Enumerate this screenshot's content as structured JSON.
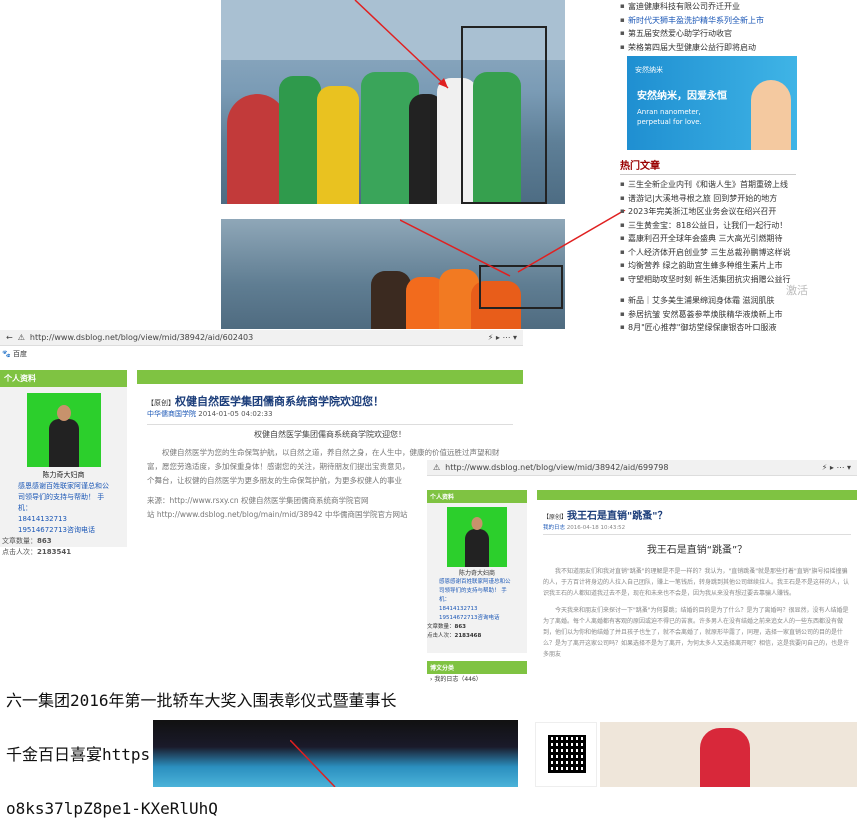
{
  "top_sidebar": {
    "items_top": [
      "富迪健康科技有限公司乔迁开业",
      "新时代天狮丰盈洗护精华系列全新上市",
      "第五届安然爱心助学行动收官",
      "荣格第四届大型健康公益行即将启动"
    ],
    "ad_brand": "安然纳米",
    "ad_brand_slogan": "因爱永恒",
    "ad_line1": "安然纳米，因爱永恒",
    "ad_line2": "Anran nanometer,",
    "ad_line3": "perpetual for love.",
    "hot_title": "热门文章",
    "hot_items": [
      "三生全新企业内刊《和谐人生》首期重磅上线",
      "谱游记|大溪地寻根之旅 回到梦开始的地方",
      "2023年完美浙江地区业务会议在绍兴召开",
      "三生黄金宝：818公益日，让我们一起行动！",
      "嘉康利召开全球年会盛典 三大高光引燃期待",
      "个人经济体开启创业梦 三生总裁孙鹏博这样说",
      "均衡营养 绿之韵助宜生蜂多种维生素片上市",
      "守望相助攻坚时刻 新生活集团抗灾捐赠公益行",
      "新品｜艾多美生浦果绵润身体霜 滋润肌肤",
      "参居抗皱 安然葛荟参萃焕肤精华液焕新上市",
      "8月\"匠心推荐\"御坊堂绿保康银杏叶口服液"
    ],
    "watermark": "激活"
  },
  "browser1": {
    "url": "http://www.dsblog.net/blog/view/mid/38942/aid/602403",
    "tab": "百度",
    "profile_header": "个人资料",
    "user_name": "陈力奇大妇商",
    "user_desc": "感恩感谢百姓联家阿谨总和公司领导们的支持与帮助！  手机：",
    "phones": "18414132713 19514672713咨询电话",
    "stats_articles_label": "文章数量：",
    "stats_articles": "863",
    "stats_visits_label": "点击人次：",
    "stats_visits": "2183541",
    "badge": "原创",
    "title": "权健自然医学集团儒商系统商学院欢迎您！",
    "meta_source": "中华儒商国学院",
    "meta_date": "2014-01-05 04:02:33",
    "heading": "权健自然医学集团儒商系统商学院欢迎您！",
    "para1": "权健自然医学为您的生命保驾护航，以自然之道，养自然之身，在人生中，健康的价值远胜过声望和财富，愿您劳逸适度，多加保重身体！感谢您的关注，期待朋友们提出宝贵意见，",
    "para2": "个舞台，让权健的自然医学为更多朋友的生命保驾护航，为更多权健人的事业",
    "source_line": "来源：http://www.rsxy.cn   权健自然医学集团儒商系统商学院官网",
    "station_line": "站  http://www.dsblog.net/blog/main/mid/38942 中华儒商国学院官方网站"
  },
  "browser2": {
    "url": "http://www.dsblog.net/blog/view/mid/38942/aid/699798",
    "profile_header": "个人资料",
    "user_name": "陈力奇大妇商",
    "user_desc": "感恩感谢百姓联家阿谨总和公司领导们的支持与帮助！  手机：",
    "phones": "18414132713 19514672713咨询电话",
    "stats_articles_label": "文章数量：",
    "stats_articles": "863",
    "stats_visits_label": "点击人次：",
    "stats_visits": "2183468",
    "category_header": "博文分类",
    "category_item": "我的日志（446）",
    "badge": "原创",
    "title": "我王石是直销\"跳蚤\"？",
    "meta_source": "我的日志",
    "meta_date": "2016-04-18 10:43:52",
    "heading": "我王石是直销“跳蚤”？",
    "para1": "我不知道朋友们和我对直销\"跳蚤\"的理解是不是一样的？我认为，\"直销跳蚤\"就是那些打着\"直销\"旗号招摇撞骗的人，于方百计将身边的人拉入自己团队，赚上一笔钱后，转身跳到其他公司继续拉人。我王石是不是这样的人，认识我王石的人都知道我过去不是，现在和未来也不会是，因为我从来没有想过要去靠骗人赚钱。",
    "para2": "今天我来和朋友们来探讨一下\"跳蚤\"为何要跳；结婚的目的是为了什么？是为了离婚吗？很显然，没有人结婚是为了离婚。每个人离婚都有客观的原因或迫不得已的苦衷。许多男人在没有结婚之前来追女人的一些东西都没有做到，他们以为你和他结婚了并且孩子也生了，就不会离婚了，就原形毕露了，同理，选择一家直销公司的目的是什么？是为了离开这家公司吗？如果选择不是为了离开，为何太多人又选择离开呢？相信，这是我要问自己的，也是许多朋友"
  },
  "caption": {
    "line1": "六一集团2016年第一批轿车大奖入围表彰仪式暨董事长",
    "line2": "千金百日喜宴https://mp.weixin.qq.com/s/",
    "line3": "o8ks37lpZ8pe1-KXeRlUhQ"
  },
  "colors": {
    "green": "#7fc342",
    "avatar_bg": "#2ccf2c",
    "link_blue": "#1b57b6",
    "title_navy": "#1b3d7a",
    "red_arrow": "#e02020"
  }
}
